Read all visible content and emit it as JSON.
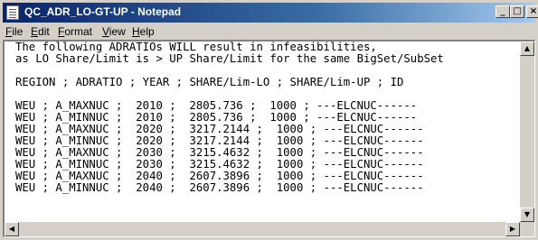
{
  "window": {
    "title": "QC_ADR_LO-GT-UP - Notepad",
    "controls": {
      "minimize": "_",
      "maximize": "□",
      "close": "×"
    }
  },
  "menu": [
    {
      "label": "File"
    },
    {
      "label": "Edit"
    },
    {
      "label": "Format"
    },
    {
      "label": "View"
    },
    {
      "label": "Help"
    }
  ],
  "document": {
    "lines": [
      "The following ADRATIOs WILL result in infeasibilities,",
      "as LO Share/Limit is > UP Share/Limit for the same BigSet/SubSet",
      "",
      "REGION ; ADRATIO ; YEAR ; SHARE/Lim-LO ; SHARE/Lim-UP ; ID",
      "",
      "WEU ; A_MAXNUC ;  2010 ;  2805.736 ;  1000 ; ---ELCNUC------",
      "WEU ; A_MINNUC ;  2010 ;  2805.736 ;  1000 ; ---ELCNUC------",
      "WEU ; A_MAXNUC ;  2020 ;  3217.2144 ;  1000 ; ---ELCNUC------",
      "WEU ; A_MINNUC ;  2020 ;  3217.2144 ;  1000 ; ---ELCNUC------",
      "WEU ; A_MAXNUC ;  2030 ;  3215.4632 ;  1000 ; ---ELCNUC------",
      "WEU ; A_MINNUC ;  2030 ;  3215.4632 ;  1000 ; ---ELCNUC------",
      "WEU ; A_MAXNUC ;  2040 ;  2607.3896 ;  1000 ; ---ELCNUC------",
      "WEU ; A_MINNUC ;  2040 ;  2607.3896 ;  1000 ; ---ELCNUC------"
    ]
  },
  "scrollbar": {
    "up": "▲",
    "down": "▼",
    "left": "◀",
    "right": "▶"
  },
  "colors": {
    "title_bar_start": "#0a246a",
    "title_bar_end": "#a6caf0",
    "chrome": "#d4d0c8"
  }
}
